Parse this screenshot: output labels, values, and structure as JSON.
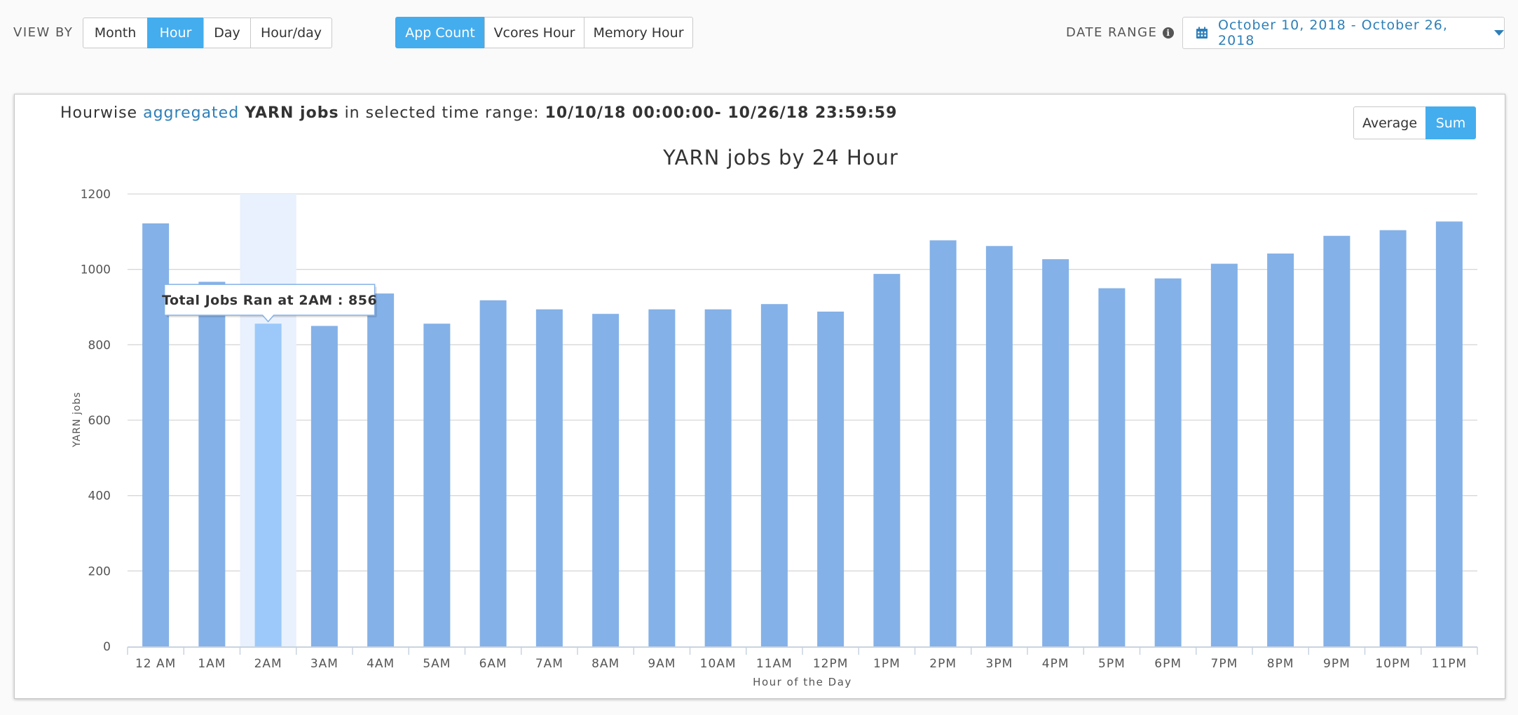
{
  "toolbar": {
    "view_by_label": "VIEW BY",
    "view_by_options": [
      "Month",
      "Hour",
      "Day",
      "Hour/day"
    ],
    "view_by_selected": "Hour",
    "metric_options": [
      "App Count",
      "Vcores Hour",
      "Memory Hour"
    ],
    "metric_selected": "App Count",
    "date_range_label": "DATE RANGE",
    "date_range_value": "October 10, 2018 - October 26, 2018"
  },
  "panel": {
    "heading_prefix": "Hourwise",
    "heading_highlight": "aggregated",
    "heading_bold": "YARN jobs",
    "heading_middle": "in selected time range:",
    "heading_range": "10/10/18 00:00:00- 10/26/18 23:59:59",
    "agg_options": [
      "Average",
      "Sum"
    ],
    "agg_selected": "Sum"
  },
  "colors": {
    "accent": "#44adee",
    "link": "#2e7fb8",
    "bar": "#84b1e7",
    "bar_hover": "#9cc9fa",
    "hover_band": "#e8f1fd"
  },
  "chart_data": {
    "type": "bar",
    "title": "YARN jobs by 24 Hour",
    "xlabel": "Hour of the Day",
    "ylabel": "YARN jobs",
    "ylim": [
      0,
      1200
    ],
    "yticks": [
      0,
      200,
      400,
      600,
      800,
      1000,
      1200
    ],
    "grid": true,
    "categories": [
      "12 AM",
      "1AM",
      "2AM",
      "3AM",
      "4AM",
      "5AM",
      "6AM",
      "7AM",
      "8AM",
      "9AM",
      "10AM",
      "11AM",
      "12PM",
      "1PM",
      "2PM",
      "3PM",
      "4PM",
      "5PM",
      "6PM",
      "7PM",
      "8PM",
      "9PM",
      "10PM",
      "11PM"
    ],
    "values": [
      1122,
      967,
      856,
      850,
      936,
      856,
      918,
      894,
      882,
      894,
      894,
      908,
      888,
      988,
      1077,
      1062,
      1027,
      950,
      976,
      1015,
      1042,
      1089,
      1104,
      1127
    ],
    "highlighted_category": "2AM",
    "tooltip": "Total Jobs Ran at 2AM : 856"
  }
}
